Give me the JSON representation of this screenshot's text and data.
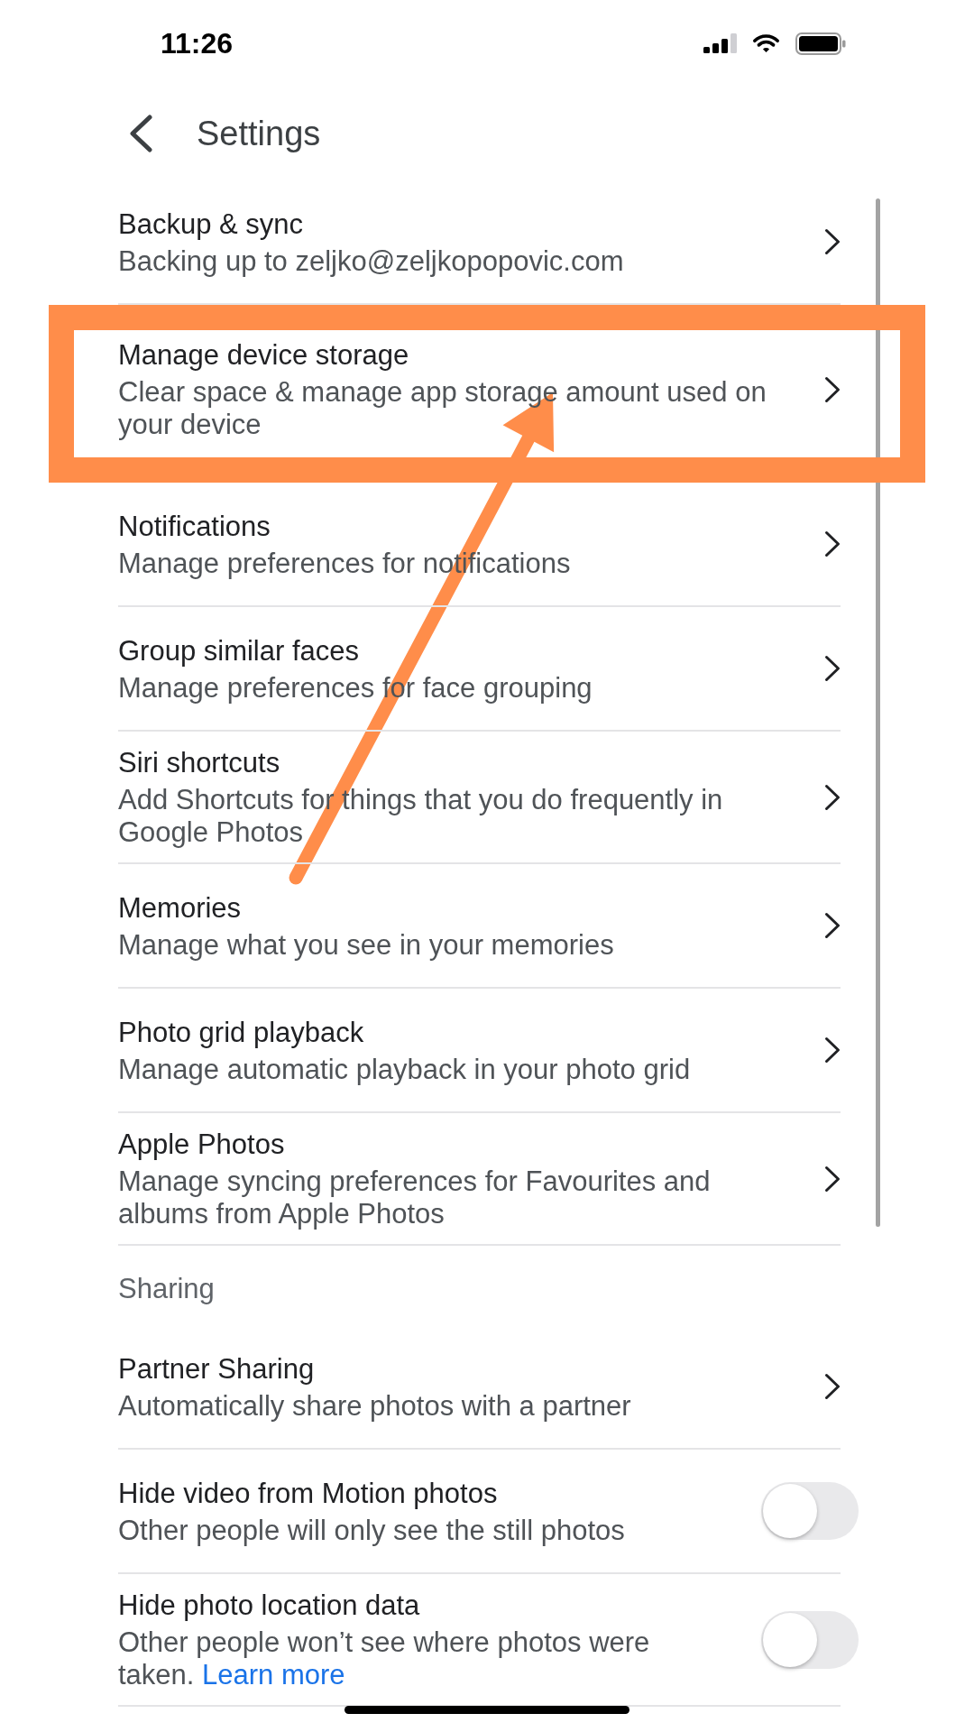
{
  "status_bar": {
    "time": "11:26"
  },
  "header": {
    "title": "Settings"
  },
  "sections": [
    {
      "items": [
        {
          "kind": "link",
          "title": "Backup & sync",
          "subtitle": "Backing up to zeljko@zeljkopopovic.com",
          "highlighted": false
        },
        {
          "kind": "link",
          "title": "Manage device storage",
          "subtitle": "Clear space & manage app storage amount used on your device",
          "highlighted": true
        },
        {
          "kind": "link",
          "title": "Notifications",
          "subtitle": "Manage preferences for notifications",
          "highlighted": false
        },
        {
          "kind": "link",
          "title": "Group similar faces",
          "subtitle": "Manage preferences for face grouping",
          "highlighted": false
        },
        {
          "kind": "link",
          "title": "Siri shortcuts",
          "subtitle": "Add Shortcuts for things that you do frequently in Google Photos",
          "highlighted": false
        },
        {
          "kind": "link",
          "title": "Memories",
          "subtitle": "Manage what you see in your memories",
          "highlighted": false
        },
        {
          "kind": "link",
          "title": "Photo grid playback",
          "subtitle": "Manage automatic playback in your photo grid",
          "highlighted": false
        },
        {
          "kind": "link",
          "title": "Apple Photos",
          "subtitle": "Manage syncing preferences for Favourites and albums from Apple Photos",
          "highlighted": false
        }
      ]
    },
    {
      "heading": "Sharing",
      "items": [
        {
          "kind": "link",
          "title": "Partner Sharing",
          "subtitle": "Automatically share photos with a partner",
          "highlighted": false
        },
        {
          "kind": "toggle",
          "title": "Hide video from Motion photos",
          "subtitle": "Other people will only see the still photos",
          "on": false,
          "highlighted": false
        },
        {
          "kind": "toggle",
          "title": "Hide photo location data",
          "subtitle": "Other people won’t see where photos were taken.",
          "link": "Learn more",
          "on": false,
          "highlighted": false
        }
      ]
    }
  ]
}
